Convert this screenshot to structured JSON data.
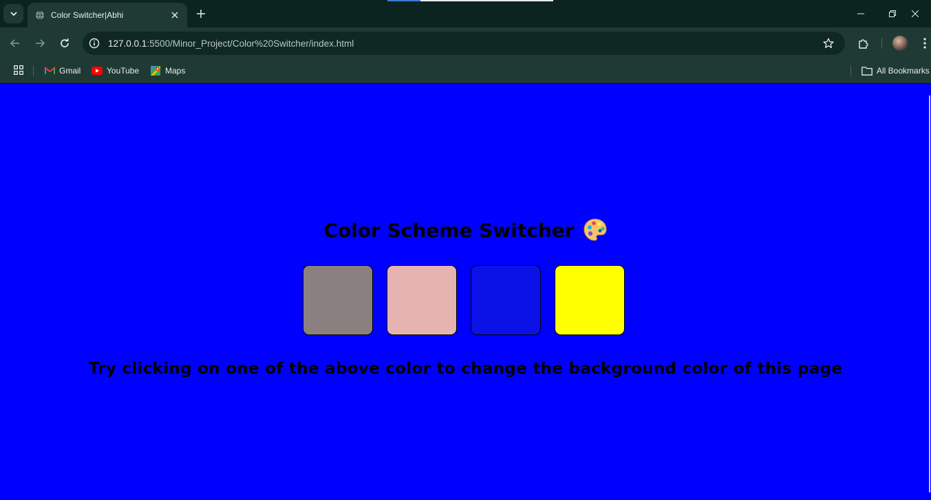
{
  "browser": {
    "tab": {
      "title": "Color Switcher|Abhi",
      "favicon": "globe-icon"
    },
    "address_bar": {
      "host": "127.0.0.1",
      "path": ":5500/Minor_Project/Color%20Switcher/index.html"
    },
    "bookmarks": [
      {
        "label": "Gmail",
        "icon": "gmail-icon"
      },
      {
        "label": "YouTube",
        "icon": "youtube-icon"
      },
      {
        "label": "Maps",
        "icon": "maps-icon"
      }
    ],
    "all_bookmarks_label": "All Bookmarks"
  },
  "page": {
    "background": "#0000ff",
    "title": "Color Scheme Switcher",
    "title_icon": "palette-icon",
    "swatches": [
      {
        "name": "grey",
        "color": "#8a8080"
      },
      {
        "name": "pink",
        "color": "#e5b3b0"
      },
      {
        "name": "blue",
        "color": "#0a12e8"
      },
      {
        "name": "yellow",
        "color": "#ffff00"
      }
    ],
    "hint": "Try clicking on one of the above color to change the background color of this page"
  }
}
